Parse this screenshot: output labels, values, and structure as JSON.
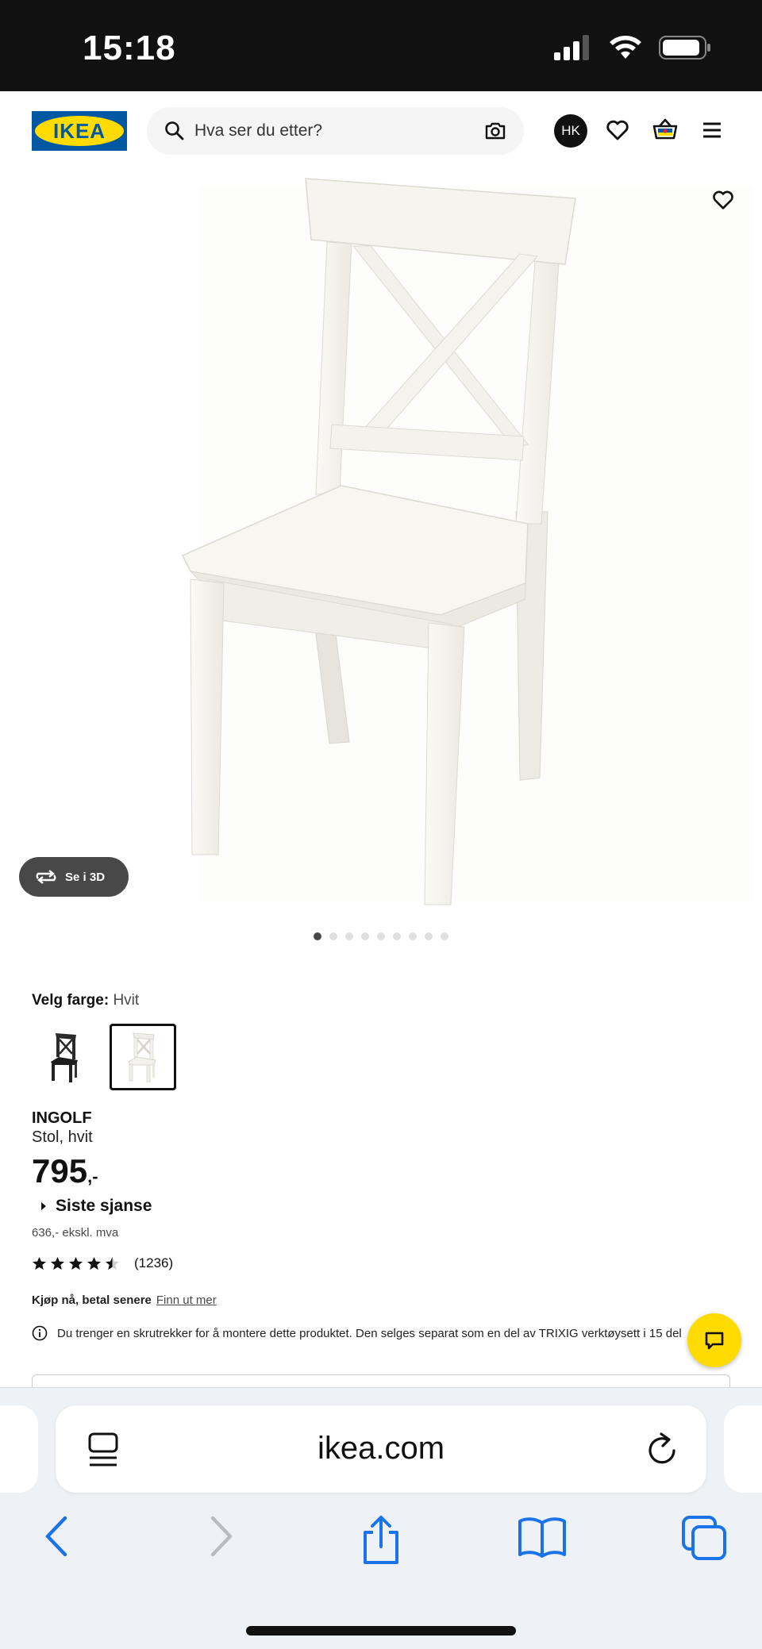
{
  "status_bar": {
    "time": "15:18"
  },
  "header": {
    "logo_text": "IKEA",
    "search_placeholder": "Hva ser du etter?",
    "avatar_initials": "HK"
  },
  "gallery": {
    "view_3d_label": "Se i 3D",
    "image_count": 9,
    "active_index": 0
  },
  "product": {
    "color_label": "Velg farge:",
    "color_value": "Hvit",
    "swatches": [
      "black",
      "white"
    ],
    "selected_swatch": 1,
    "name": "INGOLF",
    "description": "Stol, hvit",
    "price": "795",
    "price_suffix": ",-",
    "last_chance": "Siste sjanse",
    "excl_vat": "636,- ekskl. mva",
    "rating_value": 4.5,
    "rating_max": 5,
    "rating_count": "(1236)",
    "bnpl_label": "Kjøp nå, betal senere",
    "bnpl_link": "Finn ut mer",
    "notice": "Du trenger en skrutrekker for å montere dette produktet. Den selges separat som en del av TRIXIG verktøysett i 15 del"
  },
  "browser": {
    "url": "ikea.com"
  },
  "colors": {
    "ikea_blue": "#0058a3",
    "ikea_yellow": "#ffdb00",
    "ios_blue": "#1a73e8"
  }
}
